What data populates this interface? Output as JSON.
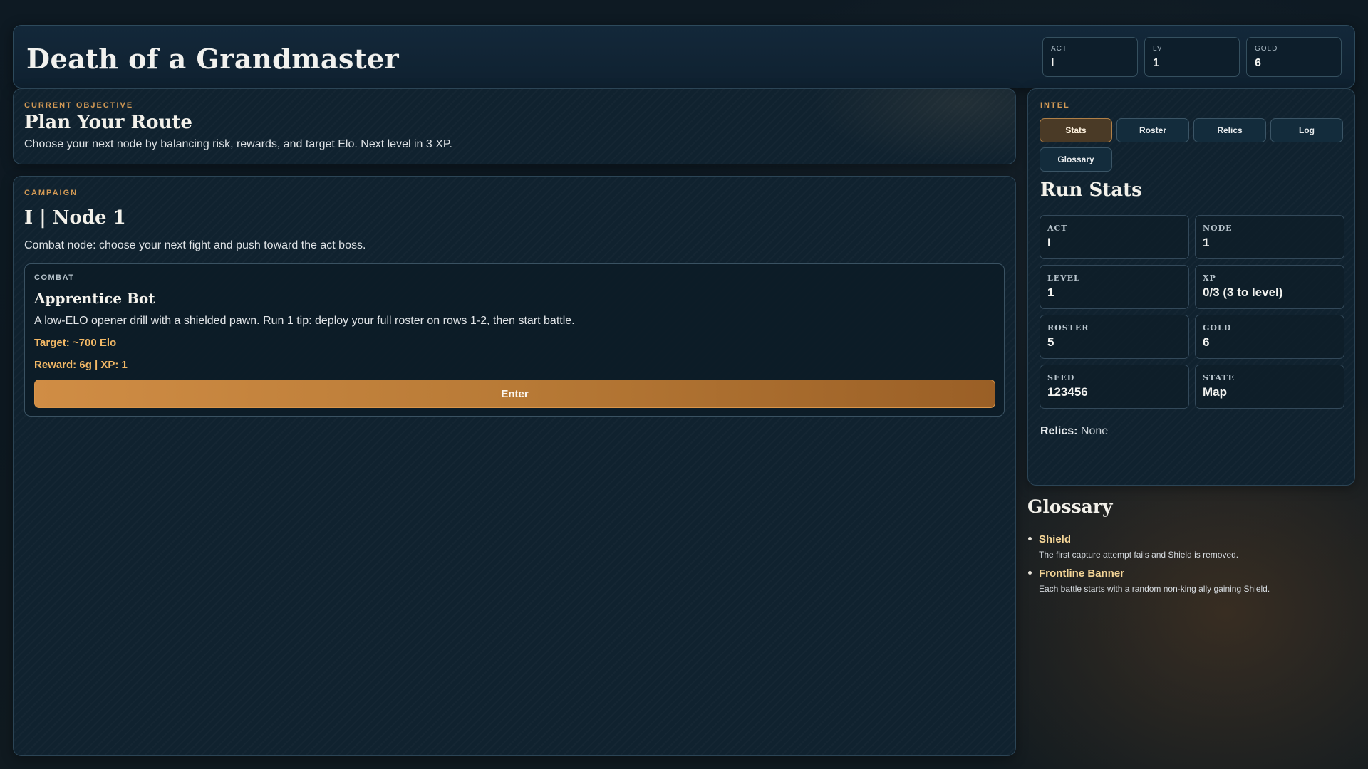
{
  "header": {
    "title": "Death of a Grandmaster",
    "stats": [
      {
        "label": "ACT",
        "value": "I"
      },
      {
        "label": "LV",
        "value": "1"
      },
      {
        "label": "GOLD",
        "value": "6"
      }
    ]
  },
  "objective": {
    "kicker": "CURRENT OBJECTIVE",
    "title": "Plan Your Route",
    "description": "Choose your next node by balancing risk, rewards, and target Elo. Next level in 3 XP."
  },
  "campaign": {
    "kicker": "CAMPAIGN",
    "title": "I | Node 1",
    "description": "Combat node: choose your next fight and push toward the act boss.",
    "node": {
      "tag": "COMBAT",
      "name": "Apprentice Bot",
      "description": "A low-ELO opener drill with a shielded pawn. Run 1 tip: deploy your full roster on rows 1-2, then start battle.",
      "target": "Target: ~700 Elo",
      "reward": "Reward: 6g | XP: 1",
      "button": "Enter"
    }
  },
  "intel": {
    "kicker": "INTEL",
    "tabs": [
      "Stats",
      "Roster",
      "Relics",
      "Log",
      "Glossary"
    ],
    "active_tab": "Stats",
    "title": "Run Stats",
    "stats": [
      {
        "label": "ACT",
        "value": "I"
      },
      {
        "label": "NODE",
        "value": "1"
      },
      {
        "label": "LEVEL",
        "value": "1"
      },
      {
        "label": "XP",
        "value": "0/3 (3 to level)"
      },
      {
        "label": "ROSTER",
        "value": "5"
      },
      {
        "label": "GOLD",
        "value": "6"
      },
      {
        "label": "SEED",
        "value": "123456"
      },
      {
        "label": "STATE",
        "value": "Map"
      }
    ],
    "relics_label": "Relics:",
    "relics_value": "None"
  },
  "glossary": {
    "title": "Glossary",
    "items": [
      {
        "term": "Shield",
        "definition": "The first capture attempt fails and Shield is removed."
      },
      {
        "term": "Frontline Banner",
        "definition": "Each battle starts with a random non-king ally gaining Shield."
      }
    ]
  },
  "colors": {
    "accent": "#d39a55",
    "highlight": "#f2b866",
    "term": "#f4d597",
    "background": "#0e1a23"
  }
}
